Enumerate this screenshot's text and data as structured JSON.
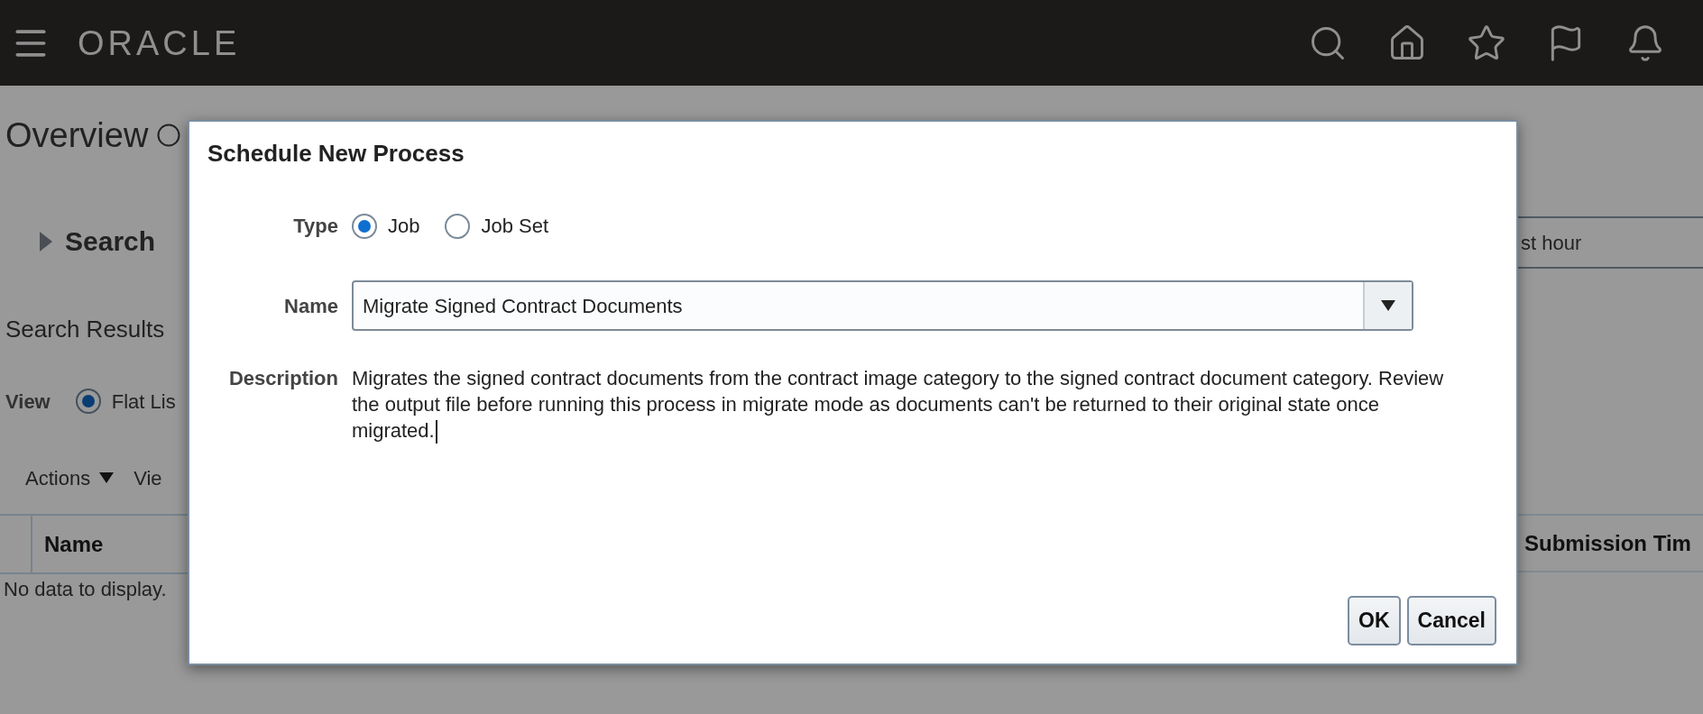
{
  "header": {
    "logo": "ORACLE"
  },
  "page": {
    "title": "Overview",
    "search_section": {
      "label": "Search",
      "expanded": false
    },
    "search_field": {
      "value": "st hour"
    },
    "results_title": "Search Results",
    "view": {
      "label": "View",
      "options": [
        {
          "label": "Flat Lis",
          "selected": true
        }
      ]
    },
    "toolbar": [
      {
        "label": "Actions",
        "kind": "menu"
      },
      {
        "label": "Vie",
        "kind": "plain"
      }
    ],
    "table": {
      "columns": [
        "Name",
        "Submission Tim"
      ],
      "empty_message": "No data to display."
    }
  },
  "dialog": {
    "title": "Schedule New Process",
    "type": {
      "label": "Type",
      "options": [
        {
          "label": "Job",
          "selected": true
        },
        {
          "label": "Job Set",
          "selected": false
        }
      ]
    },
    "name": {
      "label": "Name",
      "value": "Migrate Signed Contract Documents"
    },
    "description": {
      "label": "Description",
      "text": "Migrates the signed contract documents from the contract image category to the signed contract document category. Review the output file before running this process in migrate mode as documents can't be returned to their original state once migrated."
    },
    "buttons": [
      "OK",
      "Cancel"
    ]
  }
}
